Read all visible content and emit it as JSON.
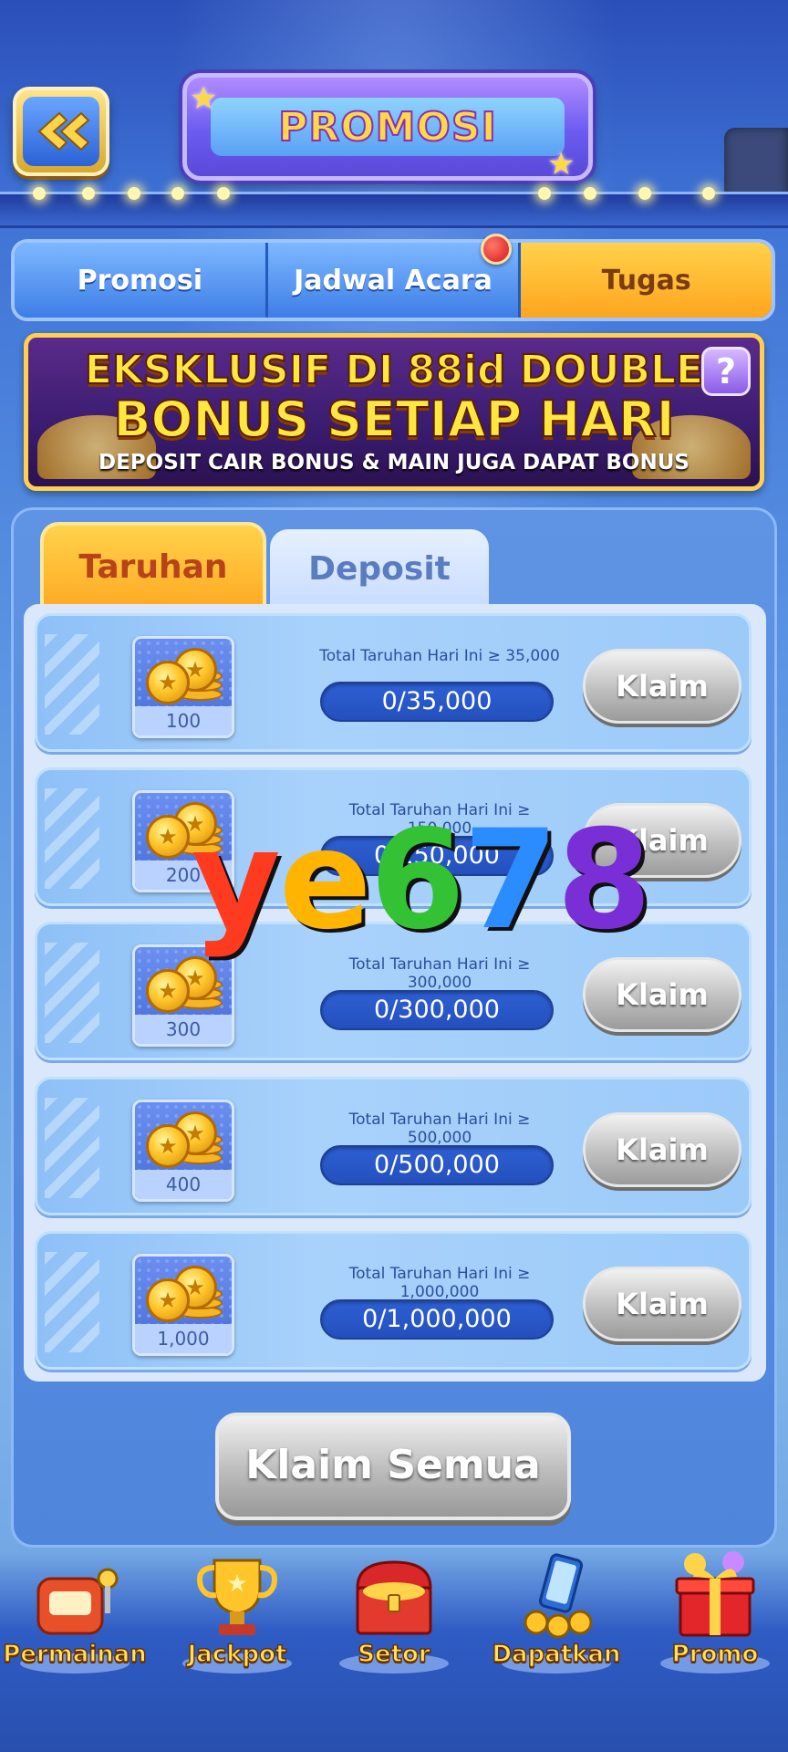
{
  "header": {
    "title": "PROMOSI",
    "back_icon": "double-chevron-left-icon"
  },
  "top_tabs": [
    {
      "label": "Promosi",
      "active": false
    },
    {
      "label": "Jadwal Acara",
      "active": false
    },
    {
      "label": "Tugas",
      "active": true
    }
  ],
  "banner": {
    "line1": "EKSKLUSIF DI 88id DOUBLE",
    "line2": "BONUS SETIAP HARI",
    "line3": "DEPOSIT CAIR BONUS  & MAIN JUGA DAPAT BONUS",
    "help": "?"
  },
  "sub_tabs": [
    {
      "label": "Taruhan",
      "active": true
    },
    {
      "label": "Deposit",
      "active": false
    }
  ],
  "tasks": [
    {
      "reward": "100",
      "requirement": "Total Taruhan Hari Ini ≥ 35,000",
      "progress": "0/35,000",
      "button": "Klaim"
    },
    {
      "reward": "200",
      "requirement": "Total Taruhan Hari Ini ≥ 150,000",
      "progress": "0/150,000",
      "button": "Klaim"
    },
    {
      "reward": "300",
      "requirement": "Total Taruhan Hari Ini ≥ 300,000",
      "progress": "0/300,000",
      "button": "Klaim"
    },
    {
      "reward": "400",
      "requirement": "Total Taruhan Hari Ini ≥ 500,000",
      "progress": "0/500,000",
      "button": "Klaim"
    },
    {
      "reward": "1,000",
      "requirement": "Total Taruhan Hari Ini ≥ 1,000,000",
      "progress": "0/1,000,000",
      "button": "Klaim"
    }
  ],
  "claim_all": "Klaim Semua",
  "nav": [
    {
      "label": "Permainan",
      "icon": "slot-machine-icon"
    },
    {
      "label": "Jackpot",
      "icon": "trophy-icon"
    },
    {
      "label": "Setor",
      "icon": "treasure-chest-icon"
    },
    {
      "label": "Dapatkan",
      "icon": "phone-coins-icon"
    },
    {
      "label": "Promo",
      "icon": "gift-box-icon"
    }
  ],
  "watermark": {
    "chars": [
      "y",
      "e",
      "6",
      "7",
      "8"
    ],
    "colors": [
      "#ff3b1f",
      "#ffb400",
      "#33c233",
      "#2a8cff",
      "#7a2fd6"
    ]
  }
}
